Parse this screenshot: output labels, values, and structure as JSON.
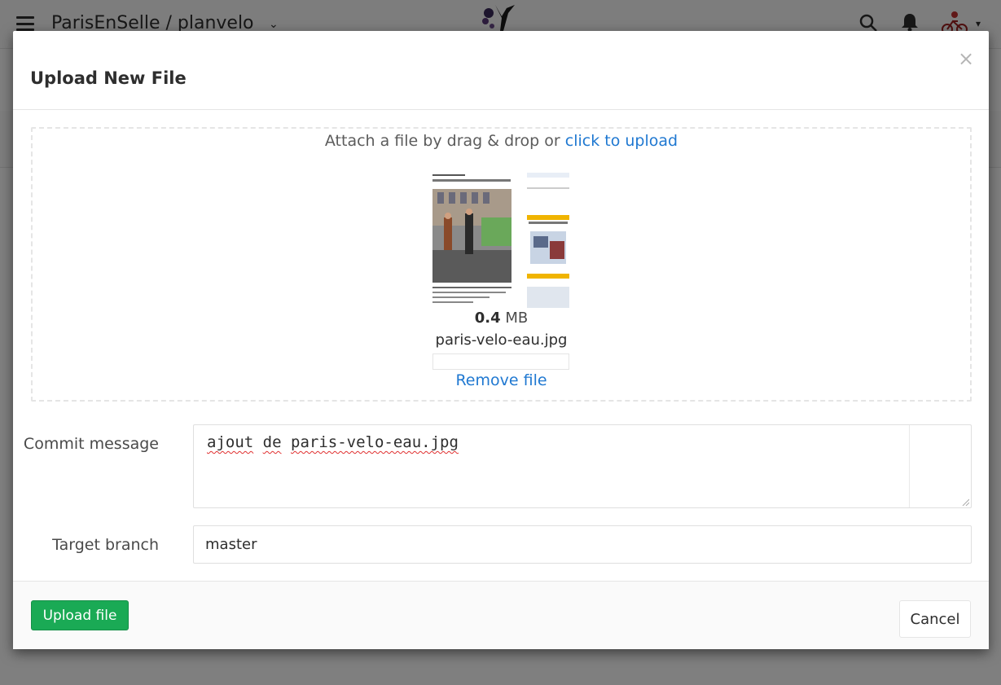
{
  "app": {
    "project_title": "ParisEnSelle / planvelo",
    "project_caret": "⌄",
    "avatar_caret": "▾",
    "icons": [
      "hamburger-icon",
      "logo-icon",
      "search-icon",
      "bell-icon",
      "avatar",
      "chevron-down-icon"
    ]
  },
  "modal": {
    "title": "Upload New File",
    "close_label": "×",
    "dropzone": {
      "text": "Attach a file by drag & drop or ",
      "link": "click to upload"
    },
    "file": {
      "size_value": "0.4",
      "size_unit": " MB",
      "name": "paris-velo-eau.jpg",
      "upload_progress": 0,
      "remove_label": "Remove file"
    },
    "commit": {
      "label": "Commit message",
      "words": [
        "ajout",
        "de",
        "paris-velo-eau.jpg"
      ]
    },
    "branch": {
      "label": "Target branch",
      "value": "master"
    },
    "footer": {
      "upload_label": "Upload file",
      "cancel_label": "Cancel"
    }
  },
  "colors": {
    "primary": "#1aaa55",
    "link": "#1f78d1",
    "overlay": "rgba(0,0,0,0.5)"
  }
}
